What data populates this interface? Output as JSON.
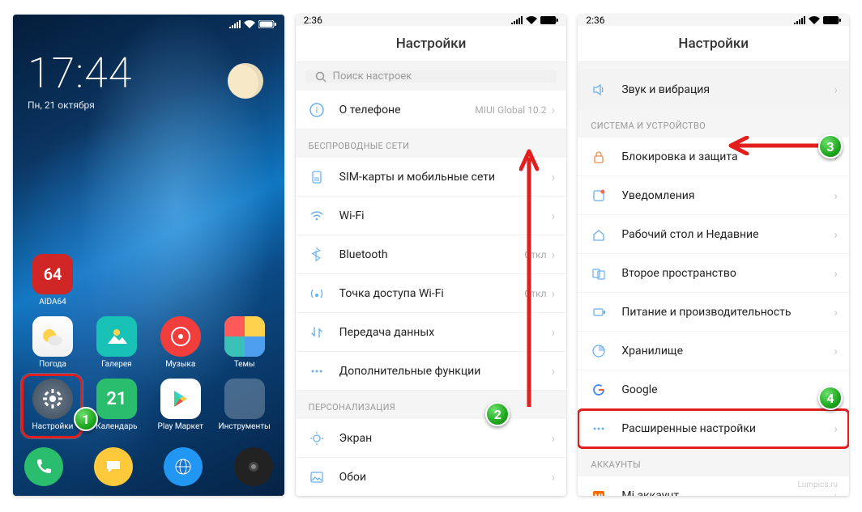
{
  "phone1": {
    "clock_time": "17:44",
    "clock_date": "Пн, 21 октября",
    "apps_row1": [
      {
        "label": "AIDA64",
        "icon": "aida64"
      }
    ],
    "apps_row2": [
      {
        "label": "Погода",
        "icon": "weather"
      },
      {
        "label": "Галерея",
        "icon": "gallery"
      },
      {
        "label": "Музыка",
        "icon": "music"
      },
      {
        "label": "Темы",
        "icon": "themes"
      }
    ],
    "apps_row3": [
      {
        "label": "Настройки",
        "icon": "settings"
      },
      {
        "label": "Календарь",
        "icon": "calendar",
        "badge": "21"
      },
      {
        "label": "Play Маркет",
        "icon": "play"
      },
      {
        "label": "Инструменты",
        "icon": "tools"
      }
    ],
    "badge1": "1"
  },
  "phone2": {
    "status_time": "2:36",
    "title": "Настройки",
    "search_placeholder": "Поиск настроек",
    "about_label": "О телефоне",
    "about_value": "MIUI Global 10.2",
    "section_wireless": "БЕСПРОВОДНЫЕ СЕТИ",
    "rows_wireless": [
      {
        "label": "SIM-карты и мобильные сети",
        "icon": "sim"
      },
      {
        "label": "Wi-Fi",
        "icon": "wifi",
        "value": ""
      },
      {
        "label": "Bluetooth",
        "icon": "bt",
        "value": "Откл"
      },
      {
        "label": "Точка доступа Wi-Fi",
        "icon": "hotspot",
        "value": "Откл"
      },
      {
        "label": "Передача данных",
        "icon": "data"
      },
      {
        "label": "Дополнительные функции",
        "icon": "more"
      }
    ],
    "section_personal": "ПЕРСОНАЛИЗАЦИЯ",
    "rows_personal": [
      {
        "label": "Экран",
        "icon": "display"
      },
      {
        "label": "Обои",
        "icon": "wallpaper"
      }
    ],
    "badge2": "2"
  },
  "phone3": {
    "status_time": "2:36",
    "title": "Настройки",
    "row_sound": "Звук и вибрация",
    "section_system": "СИСТЕМА И УСТРОЙСТВО",
    "rows_system": [
      {
        "label": "Блокировка и защита",
        "icon": "lock"
      },
      {
        "label": "Уведомления",
        "icon": "notif"
      },
      {
        "label": "Рабочий стол и Недавние",
        "icon": "home"
      },
      {
        "label": "Второе пространство",
        "icon": "space"
      },
      {
        "label": "Питание и производительность",
        "icon": "battery"
      },
      {
        "label": "Хранилище",
        "icon": "storage"
      },
      {
        "label": "Google",
        "icon": "google"
      },
      {
        "label": "Расширенные настройки",
        "icon": "more",
        "highlight": true
      }
    ],
    "section_accounts": "АККАУНТЫ",
    "row_mi": "Mi аккаунт",
    "badge3": "3",
    "badge4": "4"
  },
  "watermark": "Lumpics.ru"
}
